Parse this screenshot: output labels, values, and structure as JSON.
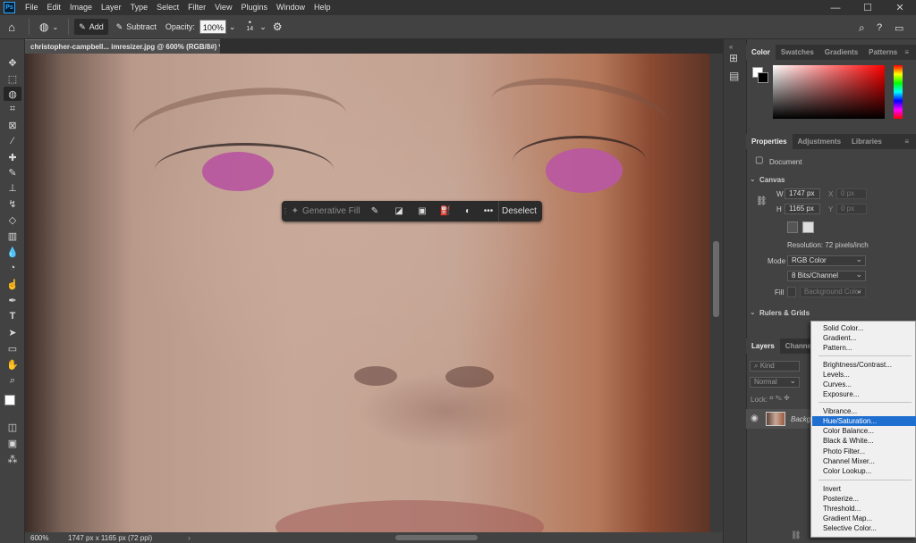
{
  "app": {
    "logo": "Ps"
  },
  "menubar": {
    "items": [
      "File",
      "Edit",
      "Image",
      "Layer",
      "Type",
      "Select",
      "Filter",
      "View",
      "Plugins",
      "Window",
      "Help"
    ]
  },
  "window_controls": {
    "minimize": "—",
    "maximize": "☐",
    "close": "✕"
  },
  "options_bar": {
    "add_label": "Add",
    "subtract_label": "Subtract",
    "opacity_label": "Opacity:",
    "opacity_value": "100%",
    "brush_size": "14"
  },
  "document": {
    "tab_title": "christopher-campbell... imresizer.jpg @ 600% (RGB/8#) *",
    "zoom": "600%",
    "info": "1747 px x 1165 px (72 ppi)"
  },
  "contextual_bar": {
    "generative_fill": "Generative Fill",
    "more": "•••",
    "deselect": "Deselect"
  },
  "color_panel": {
    "tabs": [
      "Color",
      "Swatches",
      "Gradients",
      "Patterns"
    ]
  },
  "properties_panel": {
    "tabs": [
      "Properties",
      "Adjustments",
      "Libraries"
    ],
    "doc_label": "Document",
    "canvas_header": "Canvas",
    "w_label": "W",
    "w_value": "1747 px",
    "h_label": "H",
    "h_value": "1165 px",
    "x_label": "X",
    "x_value": "0 px",
    "y_label": "Y",
    "y_value": "0 px",
    "resolution": "Resolution: 72 pixels/inch",
    "mode_label": "Mode",
    "mode_value": "RGB Color",
    "bits_value": "8 Bits/Channel",
    "fill_label": "Fill",
    "fill_value": "Background Color",
    "rulers_header": "Rulers & Grids"
  },
  "layers_panel": {
    "tabs": [
      "Layers",
      "Channels"
    ],
    "kind": "Kind",
    "blend": "Normal",
    "lock_label": "Lock:",
    "layer_name": "Backgr"
  },
  "adjustment_menu": {
    "groups": [
      [
        "Solid Color...",
        "Gradient...",
        "Pattern..."
      ],
      [
        "Brightness/Contrast...",
        "Levels...",
        "Curves...",
        "Exposure..."
      ],
      [
        "Vibrance...",
        "Hue/Saturation...",
        "Color Balance...",
        "Black & White...",
        "Photo Filter...",
        "Channel Mixer...",
        "Color Lookup..."
      ],
      [
        "Invert",
        "Posterize...",
        "Threshold...",
        "Gradient Map...",
        "Selective Color..."
      ]
    ],
    "highlighted": "Hue/Saturation..."
  },
  "colors": {
    "mask": "#b8589f",
    "highlight": "#1f6fd1",
    "ps_brand": "#31a8ff"
  }
}
